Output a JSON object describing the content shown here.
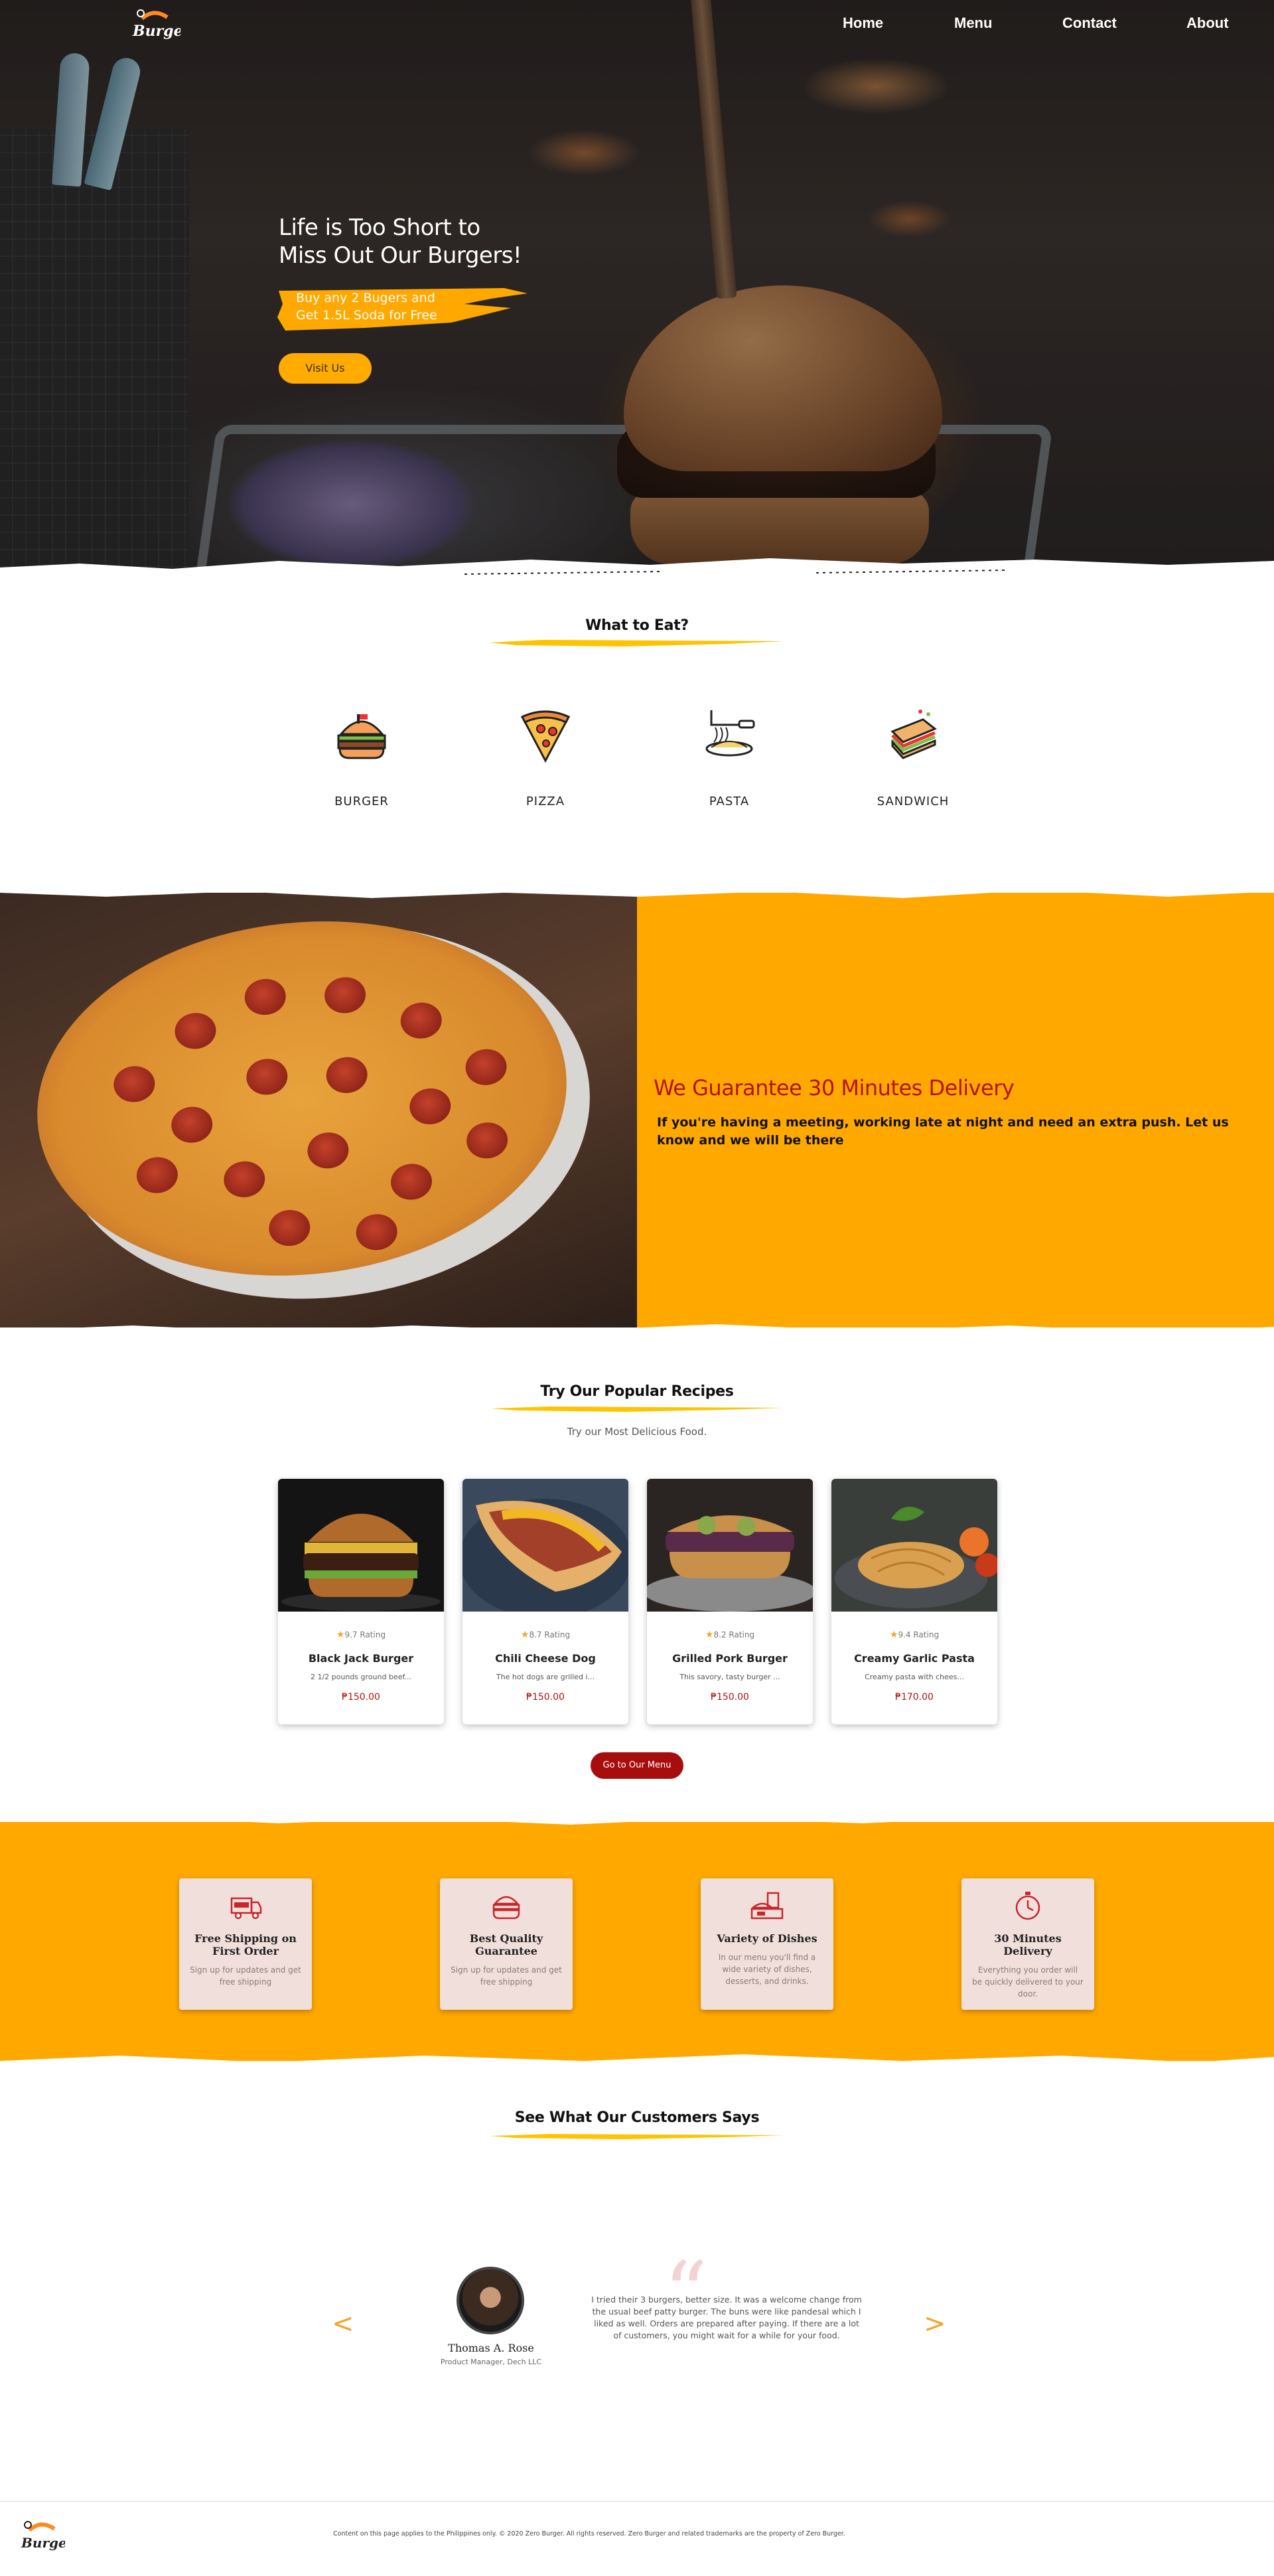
{
  "nav": {
    "items": [
      "Home",
      "Menu",
      "Contact",
      "About"
    ]
  },
  "logo": {
    "text": "Burgers",
    "icon": "burger-logo"
  },
  "hero": {
    "title_line1": "Life is Too Short to",
    "title_line2": "Miss Out Our Burgers!",
    "promo_line1": "Buy any 2 Bugers and",
    "promo_line2": "Get 1.5L Soda for Free",
    "button": "Visit Us"
  },
  "categories": {
    "title": "What to Eat?",
    "items": [
      {
        "label": "BURGER",
        "icon": "burger-icon"
      },
      {
        "label": "PIZZA",
        "icon": "pizza-icon"
      },
      {
        "label": "PASTA",
        "icon": "pasta-icon"
      },
      {
        "label": "SANDWICH",
        "icon": "sandwich-icon"
      }
    ]
  },
  "delivery": {
    "title": "We Guarantee 30 Minutes Delivery",
    "text": "If you're having a meeting, working late at night and need an extra push. Let us know and we will be there"
  },
  "recipes": {
    "title": "Try Our Popular Recipes",
    "subtitle": "Try our Most Delicious Food.",
    "cards": [
      {
        "rating": "9.7 Rating",
        "name": "Black Jack Burger",
        "desc": "2 1/2 pounds ground beef...",
        "price": "₱150.00"
      },
      {
        "rating": "8.7 Rating",
        "name": "Chili Cheese Dog",
        "desc": "The hot dogs are grilled i...",
        "price": "₱150.00"
      },
      {
        "rating": "8.2 Rating",
        "name": "Grilled Pork Burger",
        "desc": "This savory, tasty burger ...",
        "price": "₱150.00"
      },
      {
        "rating": "9.4 Rating",
        "name": "Creamy Garlic Pasta",
        "desc": "Creamy pasta with chees...",
        "price": "₱170.00"
      }
    ],
    "button": "Go to Our Menu"
  },
  "features": [
    {
      "title": "Free Shipping on First Order",
      "text": "Sign up for updates and get free shipping",
      "icon": "delivery-truck-icon"
    },
    {
      "title": "Best Quality Guarantee",
      "text": "Sign up for updates and get free shipping",
      "icon": "burger-quality-icon"
    },
    {
      "title": "Variety of Dishes",
      "text": "In our menu you'll find a wide variety of dishes, desserts, and drinks.",
      "icon": "dishes-icon"
    },
    {
      "title": "30 Minutes Delivery",
      "text": "Everything you order will be quickly delivered to your door.",
      "icon": "stopwatch-icon"
    }
  ],
  "testimonials": {
    "title": "See What Our Customers Says",
    "name": "Thomas A. Rose",
    "role": "Product Manager, Dech LLC",
    "quote": "I tried their 3 burgers, better size. It was a welcome change from the usual beef patty burger. The buns were like pandesal which I liked as well. Orders are prepared after paying. If there are a lot of customers, you might wait for a while for your food.",
    "prev": "<",
    "next": ">"
  },
  "footer": {
    "text": "Content on this page applies to the Philippines only. © 2020 Zero Burger. All rights reserved. Zero Burger and related trademarks are the property of Zero Burger."
  },
  "colors": {
    "accent": "#ffa800",
    "brand_red": "#b3130d",
    "button_red": "#a80d0d"
  }
}
